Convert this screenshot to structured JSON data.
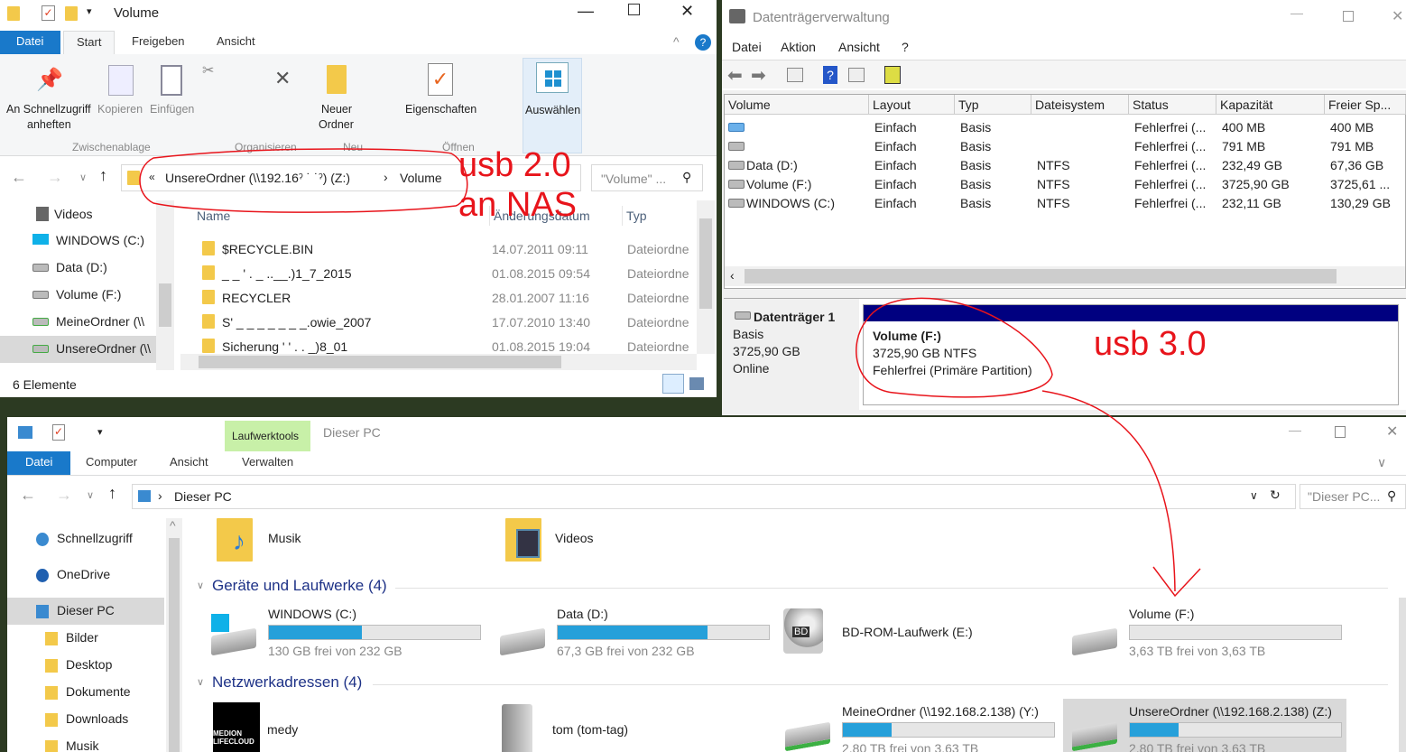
{
  "explorer_top": {
    "title": "Volume",
    "tabs": [
      "Datei",
      "Start",
      "Freigeben",
      "Ansicht"
    ],
    "ribbon": {
      "pin": "An Schnellzugriff",
      "pin2": "anheften",
      "copy": "Kopieren",
      "paste": "Einfügen",
      "group1": "Zwischenablage",
      "group2": "Organisieren",
      "new_folder": "Neuer",
      "new_folder2": "Ordner",
      "group3": "Neu",
      "properties": "Eigenschaften",
      "group4": "Öffnen",
      "select": "Auswählen"
    },
    "address": {
      "prefix": "«",
      "part1": "UnsereOrdner (\\\\192.16ˀ ˙ ˙ˀ) (Z:)",
      "sep": "›",
      "part2": "Volume"
    },
    "search_placeholder": "\"Volume\" ...",
    "nav": [
      "Videos",
      "WINDOWS (C:)",
      "Data (D:)",
      "Volume (F:)",
      "MeineOrdner (\\\\",
      "UnsereOrdner (\\\\"
    ],
    "columns": [
      "Name",
      "Änderungsdatum",
      "Typ"
    ],
    "files": [
      {
        "name": "$RECYCLE.BIN",
        "date": "14.07.2011 09:11",
        "type": "Dateiordne"
      },
      {
        "name": "_ _ ' . _ ..__.)1_7_2015",
        "date": "01.08.2015 09:54",
        "type": "Dateiordne"
      },
      {
        "name": "RECYCLER",
        "date": "28.01.2007 11:16",
        "type": "Dateiordne"
      },
      {
        "name": "S' _ _ _ _ _ _ _.owie_2007",
        "date": "17.07.2010 13:40",
        "type": "Dateiordne"
      },
      {
        "name": "Sicherung ' ' . . _)8_01",
        "date": "01.08.2015 19:04",
        "type": "Dateiordne"
      }
    ],
    "status": "6 Elemente"
  },
  "disk_mgmt": {
    "title": "Datenträgerverwaltung",
    "menu": [
      "Datei",
      "Aktion",
      "Ansicht",
      "?"
    ],
    "columns": [
      "Volume",
      "Layout",
      "Typ",
      "Dateisystem",
      "Status",
      "Kapazität",
      "Freier Sp..."
    ],
    "rows": [
      {
        "volume": "",
        "layout": "Einfach",
        "typ": "Basis",
        "fs": "",
        "status": "Fehlerfrei (...",
        "cap": "400 MB",
        "free": "400 MB"
      },
      {
        "volume": "",
        "layout": "Einfach",
        "typ": "Basis",
        "fs": "",
        "status": "Fehlerfrei (...",
        "cap": "791 MB",
        "free": "791 MB"
      },
      {
        "volume": "Data (D:)",
        "layout": "Einfach",
        "typ": "Basis",
        "fs": "NTFS",
        "status": "Fehlerfrei (...",
        "cap": "232,49 GB",
        "free": "67,36 GB"
      },
      {
        "volume": "Volume (F:)",
        "layout": "Einfach",
        "typ": "Basis",
        "fs": "NTFS",
        "status": "Fehlerfrei (...",
        "cap": "3725,90 GB",
        "free": "3725,61 ..."
      },
      {
        "volume": "WINDOWS (C:)",
        "layout": "Einfach",
        "typ": "Basis",
        "fs": "NTFS",
        "status": "Fehlerfrei (...",
        "cap": "232,11 GB",
        "free": "130,29 GB"
      }
    ],
    "disk": {
      "name": "Datenträger 1",
      "type": "Basis",
      "size": "3725,90 GB",
      "state": "Online",
      "partition": {
        "name": "Volume  (F:)",
        "size": "3725,90 GB NTFS",
        "status": "Fehlerfrei (Primäre Partition)"
      }
    },
    "partition_color": "#000080"
  },
  "explorer_bottom": {
    "context_tab": "Laufwerktools",
    "title": "Dieser PC",
    "tabs": [
      "Datei",
      "Computer",
      "Ansicht",
      "Verwalten"
    ],
    "address": "Dieser PC",
    "search_placeholder": "\"Dieser PC...",
    "nav": [
      "Schnellzugriff",
      "OneDrive",
      "Dieser PC",
      "Bilder",
      "Desktop",
      "Dokumente",
      "Downloads",
      "Musik"
    ],
    "folders": [
      "Musik",
      "Videos"
    ],
    "devices_header": "Geräte und Laufwerke (4)",
    "devices": [
      {
        "name": "WINDOWS (C:)",
        "free": "130 GB frei von 232 GB",
        "used_pct": 44
      },
      {
        "name": "Data (D:)",
        "free": "67,3 GB frei von 232 GB",
        "used_pct": 71
      },
      {
        "name": "BD-ROM-Laufwerk (E:)"
      },
      {
        "name": "Volume (F:)",
        "free": "3,63 TB frei von 3,63 TB",
        "used_pct": 0
      }
    ],
    "network_header": "Netzwerkadressen (4)",
    "network": [
      {
        "name": "medy",
        "logo": "MEDION LIFECLOUD"
      },
      {
        "name": "tom (tom-tag)"
      },
      {
        "name": "MeineOrdner (\\\\192.168.2.138) (Y:)",
        "free": "2,80 TB frei von 3,63 TB",
        "used_pct": 23
      },
      {
        "name": "UnsereOrdner (\\\\192.168.2.138) (Z:)",
        "free": "2,80 TB frei von 3,63 TB",
        "used_pct": 23
      }
    ],
    "bd_label": "BD"
  },
  "annotations": {
    "usb2": "usb 2.0",
    "nas": "an NAS",
    "usb3": "usb 3.0",
    "color": "#e8141b"
  }
}
